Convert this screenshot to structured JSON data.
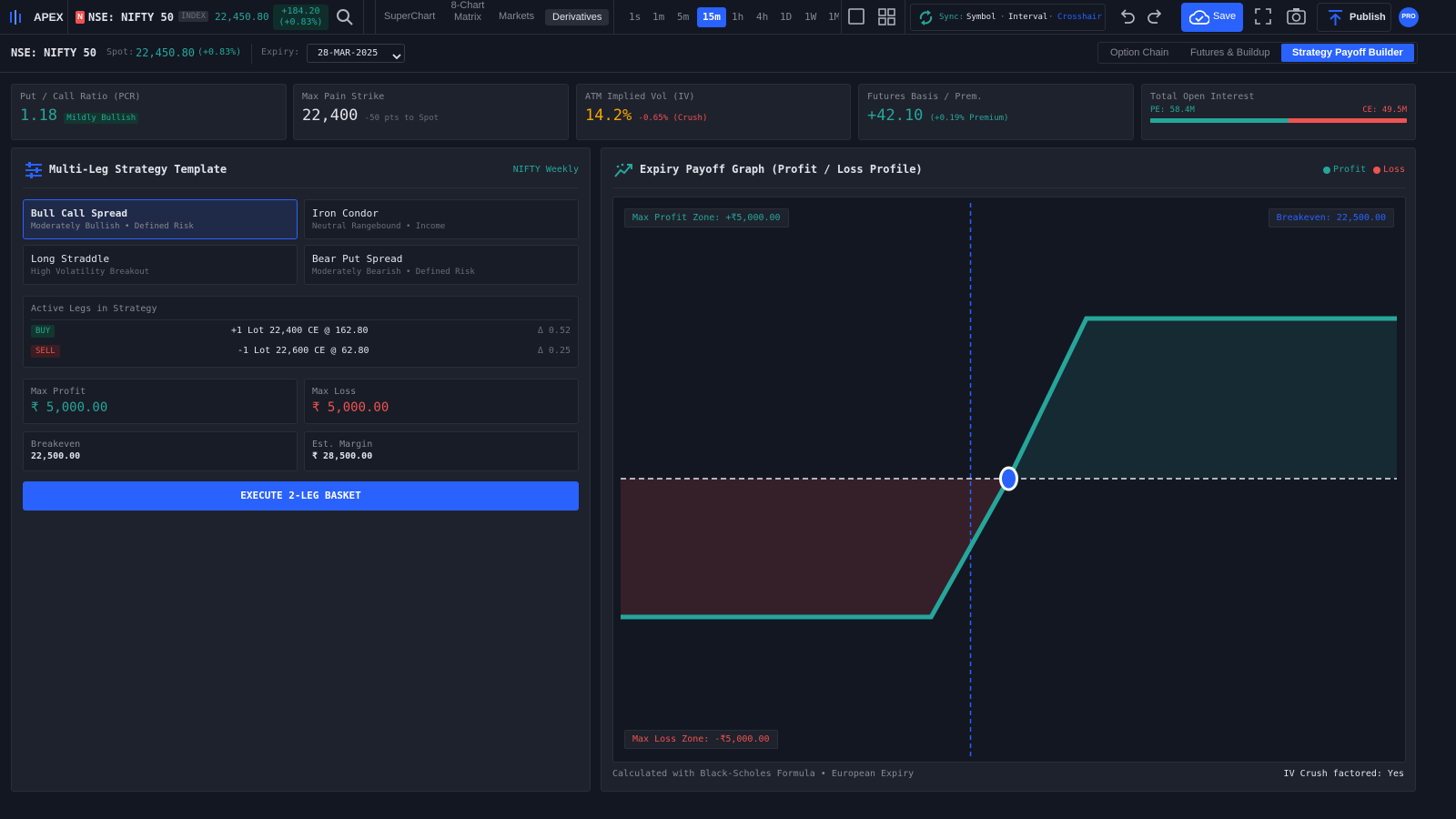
{
  "topbar": {
    "brand": "APEX",
    "symbol": "NSE: NIFTY 50",
    "symbol_badge": "N",
    "index_tag": "INDEX",
    "price": "22,450.80",
    "change": "+184.20",
    "change_pct": "(+0.83%)",
    "nav": [
      "SuperChart",
      "8-Chart Matrix",
      "Markets",
      "Derivatives"
    ],
    "nav_active": "Derivatives",
    "timeframes": [
      "1s",
      "1m",
      "5m",
      "15m",
      "1h",
      "4h",
      "1D",
      "1W",
      "1M"
    ],
    "timeframe_active": "15m",
    "sync_label": "Sync:",
    "sync_symbol": "Symbol",
    "sync_interval": "Interval",
    "sync_crosshair": "Crosshair",
    "sync_sep": "·",
    "save_label": "Save",
    "publish_label": "Publish",
    "pro_badge": "PRO"
  },
  "subbar": {
    "symbol": "NSE: NIFTY 50",
    "spot_label": "Spot:",
    "spot_value": "22,450.80",
    "spot_change": "(+0.83%)",
    "expiry_label": "Expiry:",
    "expiry_value": "28-MAR-2025",
    "tabs": [
      "Option Chain",
      "Futures & Buildup",
      "Strategy Payoff Builder"
    ],
    "tab_active": "Strategy Payoff Builder"
  },
  "stats": [
    {
      "label": "Put / Call Ratio (PCR)",
      "value": "1.18",
      "sub": "Mildly Bullish"
    },
    {
      "label": "Max Pain Strike",
      "value": "22,400",
      "sub": "-50 pts to Spot"
    },
    {
      "label": "ATM Implied Vol (IV)",
      "value": "14.2%",
      "sub": "-0.65% (Crush)"
    },
    {
      "label": "Futures Basis / Prem.",
      "value": "+42.10",
      "sub": "(+0.19% Premium)"
    },
    {
      "label": "Total Open Interest",
      "pe": "PE: 58.4M",
      "ce": "CE: 49.5M",
      "pe_share": 0.54
    }
  ],
  "colors": {
    "accent": "#2962ff",
    "profit": "#26a69a",
    "loss": "#ef5350",
    "warn": "#f7a600"
  },
  "strategy": {
    "title": "Multi-Leg Strategy Template",
    "badge": "NIFTY Weekly",
    "templates": [
      {
        "name": "Bull Call Spread",
        "desc": "Moderately Bullish • Defined Risk"
      },
      {
        "name": "Iron Condor",
        "desc": "Neutral Rangebound • Income"
      },
      {
        "name": "Long Straddle",
        "desc": "High Volatility Breakout"
      },
      {
        "name": "Bear Put Spread",
        "desc": "Moderately Bearish • Defined Risk"
      }
    ],
    "active_template": "Bull Call Spread",
    "legs_title": "Active Legs in Strategy",
    "legs": [
      {
        "side": "BUY",
        "desc": "+1 Lot 22,400 CE @ 162.80",
        "delta": "Δ 0.52"
      },
      {
        "side": "SELL",
        "desc": "-1 Lot 22,600 CE @ 62.80",
        "delta": "Δ 0.25"
      }
    ],
    "max_profit_label": "Max Profit",
    "max_profit": "₹ 5,000.00",
    "max_loss_label": "Max Loss",
    "max_loss": "₹ 5,000.00",
    "breakeven_label": "Breakeven",
    "breakeven": "22,500.00",
    "margin_label": "Est. Margin",
    "margin": "₹ 28,500.00",
    "execute_label": "EXECUTE 2-LEG BASKET"
  },
  "payoff": {
    "title": "Expiry Payoff Graph (Profit / Loss Profile)",
    "legend_profit": "Profit",
    "legend_loss": "Loss",
    "max_profit_zone": "Max Profit Zone: +₹5,000.00",
    "breakeven_tag": "Breakeven: 22,500.00",
    "max_loss_zone": "Max Loss Zone: -₹5,000.00",
    "footer_left": "Calculated with Black-Scholes Formula • European Expiry",
    "footer_right": "IV Crush factored: Yes"
  },
  "chart_data": {
    "type": "line",
    "title": "Expiry Payoff Graph (Profit / Loss Profile)",
    "x": [
      22000,
      22400,
      22500,
      22600,
      23000
    ],
    "series": [
      {
        "name": "",
        "values": [
          -5000,
          -5000,
          0,
          5000,
          5000
        ]
      }
    ],
    "breakeven": 22500,
    "spot": 22450.8,
    "ylim": [
      -10000,
      10000
    ],
    "grid": false
  }
}
